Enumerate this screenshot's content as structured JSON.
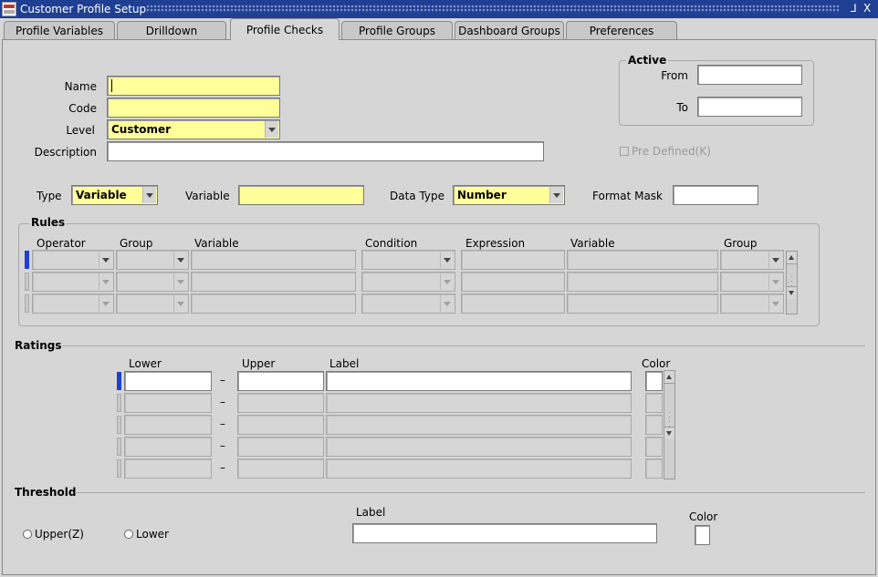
{
  "window": {
    "title": "Customer Profile Setup",
    "controls": [
      "⅃",
      "X"
    ]
  },
  "tabs": [
    {
      "label": "Profile Variables"
    },
    {
      "label": "Drilldown"
    },
    {
      "label": "Profile Checks"
    },
    {
      "label": "Profile Groups"
    },
    {
      "label": "Dashboard Groups"
    },
    {
      "label": "Preferences"
    }
  ],
  "form": {
    "name_label": "Name",
    "name_value": "",
    "code_label": "Code",
    "code_value": "",
    "level_label": "Level",
    "level_value": "Customer",
    "description_label": "Description",
    "description_value": ""
  },
  "active": {
    "title": "Active",
    "from_label": "From",
    "to_label": "To",
    "from_value": "",
    "to_value": ""
  },
  "predefined": {
    "label": "Pre Defined(K)",
    "checked": false
  },
  "criteria": {
    "type_label": "Type",
    "type_value": "Variable",
    "variable_label": "Variable",
    "variable_value": "",
    "datatype_label": "Data Type",
    "datatype_value": "Number",
    "formatmask_label": "Format Mask",
    "formatmask_value": ""
  },
  "rules": {
    "title": "Rules",
    "columns": [
      "Operator",
      "Group",
      "Variable",
      "Condition",
      "Expression",
      "Variable",
      "Group"
    ]
  },
  "ratings": {
    "title": "Ratings",
    "columns": [
      "Lower",
      "Upper",
      "Label",
      "Color"
    ],
    "separator": "–"
  },
  "threshold": {
    "title": "Threshold",
    "upper_label": "Upper(Z)",
    "lower_label": "Lower",
    "label_header": "Label",
    "color_header": "Color",
    "label_value": ""
  }
}
